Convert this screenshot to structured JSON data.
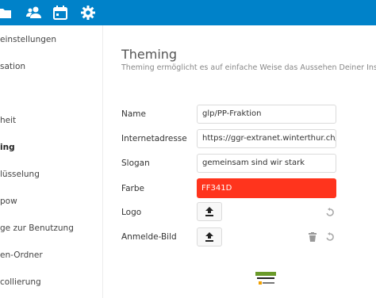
{
  "colors": {
    "topbar": "#0082c9",
    "theme_color": "#FF341D"
  },
  "topbar": {
    "icons": [
      "files-icon",
      "contacts-icon",
      "calendar-icon",
      "settings-icon"
    ]
  },
  "sidebar": {
    "items": [
      {
        "label": "einstellungen"
      },
      {
        "label": "sation"
      },
      {
        "label": "heit"
      },
      {
        "label": "ing",
        "active": true
      },
      {
        "label": "lüsselung"
      },
      {
        "label": "pow"
      },
      {
        "label": "ge zur Benutzung"
      },
      {
        "label": "en-Ordner"
      },
      {
        "label": "collierung"
      }
    ]
  },
  "theming": {
    "title": "Theming",
    "subtitle": "Theming ermöglicht es auf einfache Weise das Aussehen Deiner Instal",
    "name_label": "Name",
    "name_value": "glp/PP-Fraktion",
    "url_label": "Internetadresse",
    "url_value": "https://ggr-extranet.winterthur.ch/d",
    "slogan_label": "Slogan",
    "slogan_value": "gemeinsam sind wir stark",
    "color_label": "Farbe",
    "color_value": "FF341D",
    "logo_label": "Logo",
    "login_label": "Anmelde-Bild"
  }
}
